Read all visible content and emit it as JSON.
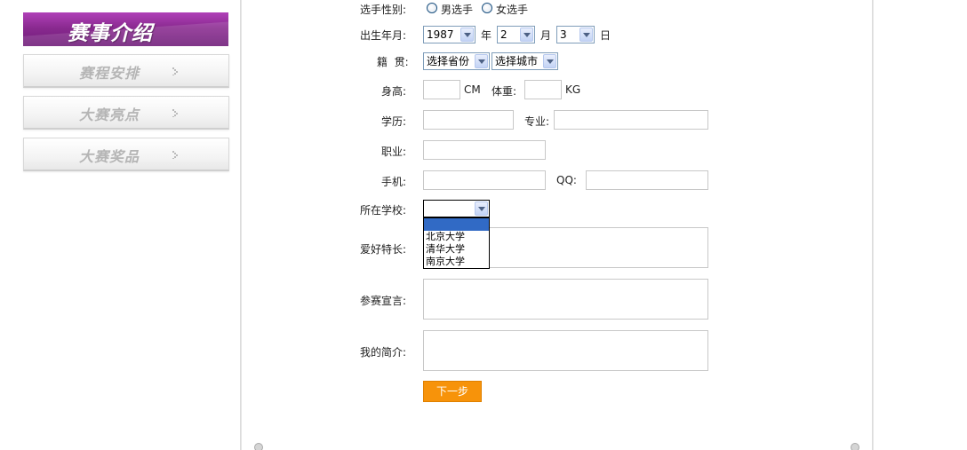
{
  "sidebar": {
    "header": "赛事介绍",
    "items": [
      {
        "label": "赛程安排"
      },
      {
        "label": "大赛亮点"
      },
      {
        "label": "大赛奖品"
      }
    ]
  },
  "form": {
    "gender": {
      "label": "选手性别:",
      "options": [
        "男选手",
        "女选手"
      ]
    },
    "birth": {
      "label": "出生年月:",
      "year": "1987",
      "year_unit": "年",
      "month": "2",
      "month_unit": "月",
      "day": "3",
      "day_unit": "日"
    },
    "origin": {
      "label": "籍  贯:",
      "province": "选择省份",
      "city": "选择城市"
    },
    "height": {
      "label": "身高:",
      "unit": "CM"
    },
    "weight": {
      "label": "体重:",
      "unit": "KG"
    },
    "education": {
      "label": "学历:"
    },
    "major": {
      "label": "专业:"
    },
    "occupation": {
      "label": "职业:"
    },
    "phone": {
      "label": "手机:"
    },
    "qq": {
      "label": "QQ:"
    },
    "school": {
      "label": "所在学校:",
      "value": "",
      "options": [
        "",
        "北京大学",
        "清华大学",
        "南京大学"
      ]
    },
    "hobbies": {
      "label": "爱好特长:"
    },
    "declaration": {
      "label": "参赛宣言:"
    },
    "intro": {
      "label": "我的简介:"
    },
    "next_button": "下一步"
  },
  "colors": {
    "accent": "#f7930a",
    "sidebar_header": "#8a2a90",
    "selection": "#316ac5"
  }
}
